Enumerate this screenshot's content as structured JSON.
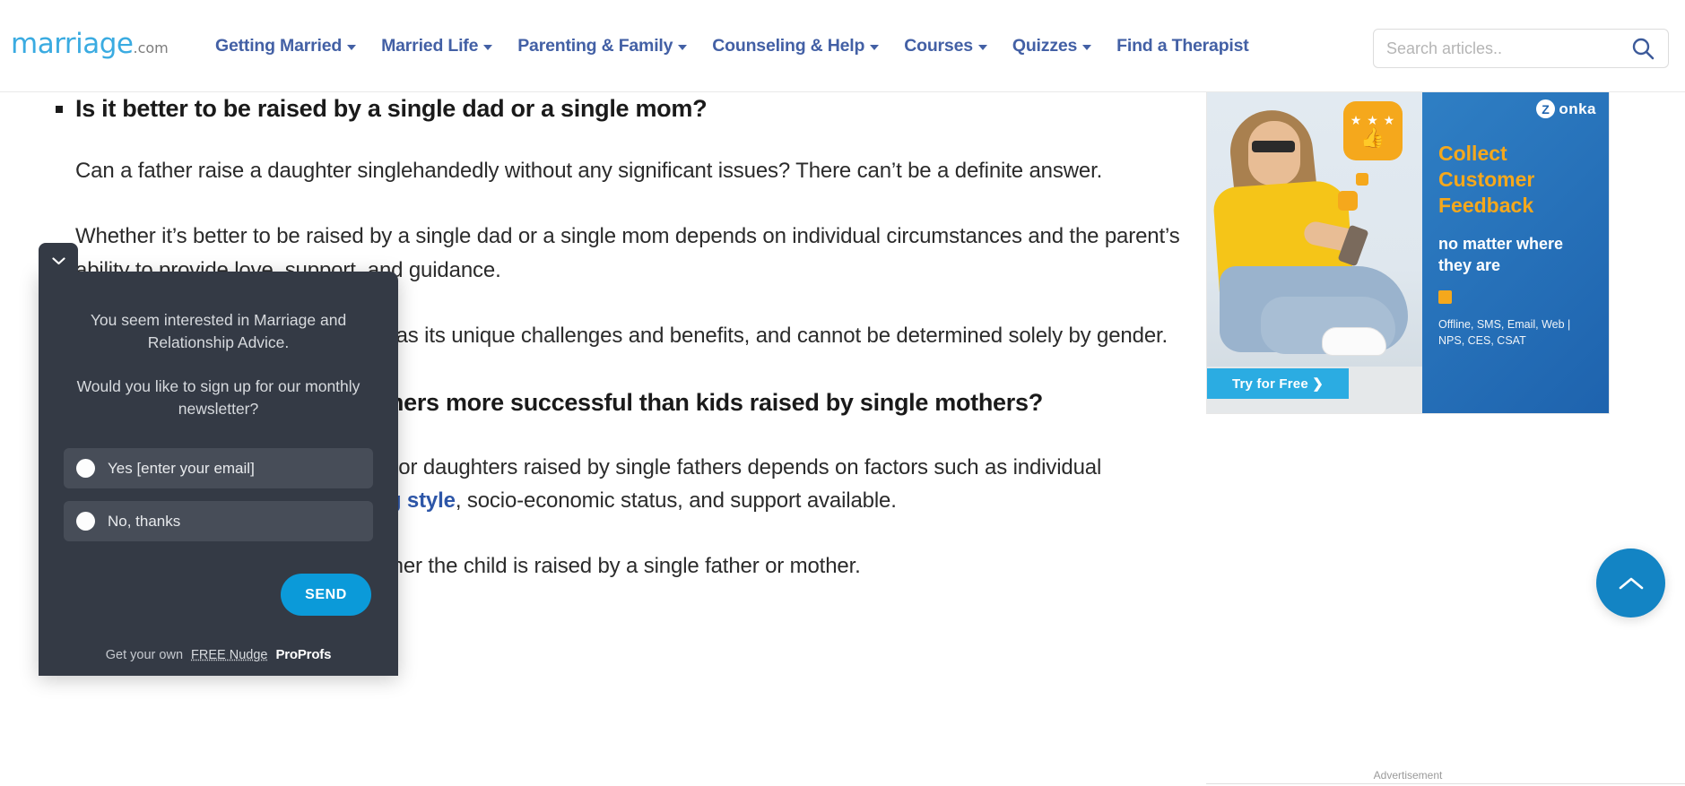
{
  "header": {
    "logo_main": "marriage",
    "logo_tld": ".com",
    "nav_items": [
      {
        "label": "Getting Married",
        "has_caret": true
      },
      {
        "label": "Married Life",
        "has_caret": true
      },
      {
        "label": "Parenting & Family",
        "has_caret": true
      },
      {
        "label": "Counseling & Help",
        "has_caret": true
      },
      {
        "label": "Courses",
        "has_caret": true
      },
      {
        "label": "Quizzes",
        "has_caret": true
      },
      {
        "label": "Find a Therapist",
        "has_caret": false
      }
    ],
    "search": {
      "placeholder": "Search articles..",
      "value": "",
      "icon": "search-icon"
    }
  },
  "article": {
    "heading": "Is it better to be raised by a single dad or a single mom?",
    "para_1": "Can a father raise a daughter singlehandedly without any significant issues? There can’t be a definite answer.",
    "para_2": "Whether it’s better to be raised by a single dad or a single mom depends on individual circumstances and the parent’s ability to provide love, support, and guidance.",
    "para_3": "Children raised by single fathers has its unique challenges and benefits, and cannot be determined solely by gender.",
    "heading_2": "Are kids raised by single fathers more successful than kids raised by single mothers?",
    "para_4_before": "The potential for success for sons or daughters raised by single fathers depends on factors such as individual personality, the parent’s ",
    "para_4_link": "parenting style",
    "para_4_after": ", socio-economic status, and support available.",
    "para_5": "It does not solely depend on whether the child is raised by a single father or mother."
  },
  "advertisement": {
    "label": "Advertisement",
    "brand": "onka",
    "brand_mark": "Z",
    "headline": "Collect Customer Feedback",
    "subheadline": "no matter where they are",
    "footnote": "Offline, SMS, Email, Web | NPS, CES, CSAT",
    "cta": "Try for Free  ❯",
    "badge_stars": "★ ★ ★",
    "badge_thumb": "👍"
  },
  "nudge": {
    "collapse_icon": "chevron-down-icon",
    "message_1": "You seem interested in Marriage and Relationship Advice.",
    "message_2": "Would you like to sign up for our monthly newsletter?",
    "options": [
      {
        "label": "Yes [enter your email]",
        "selected": false
      },
      {
        "label": "No, thanks",
        "selected": false
      }
    ],
    "send_label": "SEND",
    "footer_prefix": "Get your own",
    "footer_link": "FREE Nudge",
    "footer_brand": "ProProfs"
  },
  "scroll_top": {
    "icon": "chevron-up-icon"
  },
  "colors": {
    "nav_blue": "#4360a5",
    "logo_blue": "#3aabe1",
    "accent_blue": "#0b9ad9",
    "nudge_bg": "#343a45",
    "nudge_option_bg": "#474d58",
    "ad_orange": "#f5a81c",
    "ad_blue": "#1e63ae",
    "link_blue": "#2d56a8"
  }
}
